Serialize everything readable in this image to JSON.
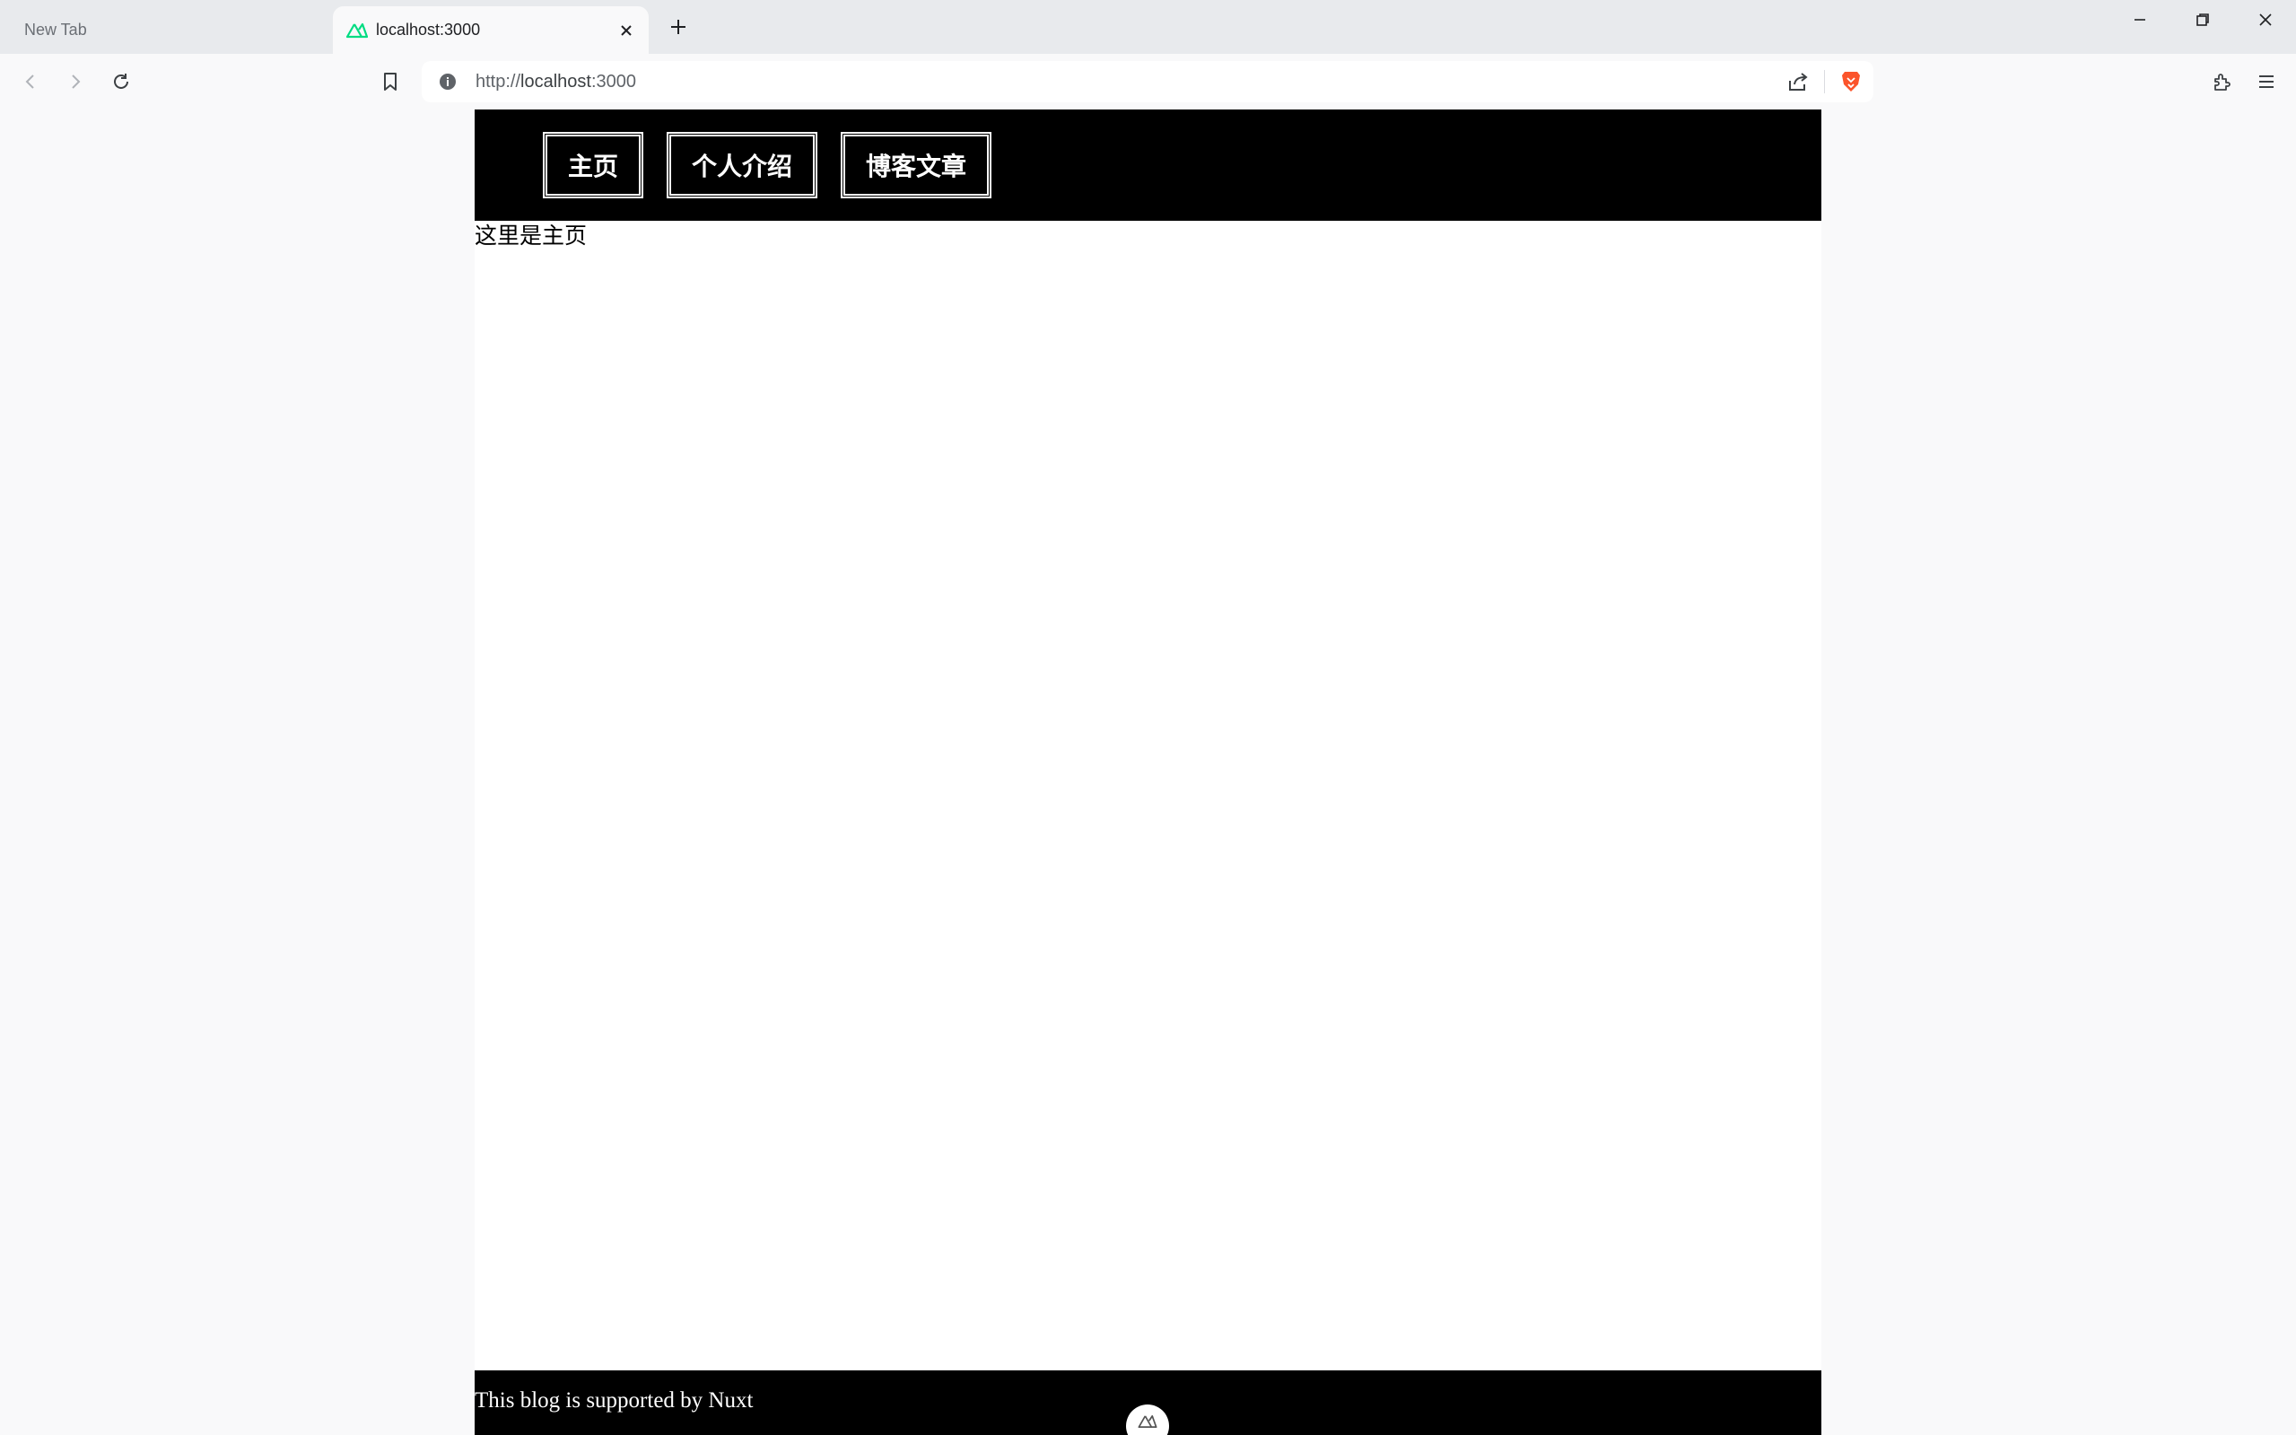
{
  "browser": {
    "tabs": [
      {
        "title": "New Tab",
        "active": false
      },
      {
        "title": "localhost:3000",
        "active": true,
        "favicon": "nuxt-logo-icon"
      }
    ],
    "url": {
      "scheme": "http://",
      "host": "localhost",
      "port": ":3000"
    },
    "colors": {
      "tabstrip": "#e8eaed",
      "toolbar": "#f9f9fa",
      "brave": "#fb542b",
      "nuxt": "#00dc82"
    }
  },
  "site": {
    "nav": [
      {
        "label": "主页"
      },
      {
        "label": "个人介绍"
      },
      {
        "label": "博客文章"
      }
    ],
    "content_text": "这里是主页",
    "footer_text": "This blog is supported by Nuxt",
    "colors": {
      "header": "#000000",
      "nav_text": "#ffffff",
      "body": "#ffffff"
    }
  }
}
